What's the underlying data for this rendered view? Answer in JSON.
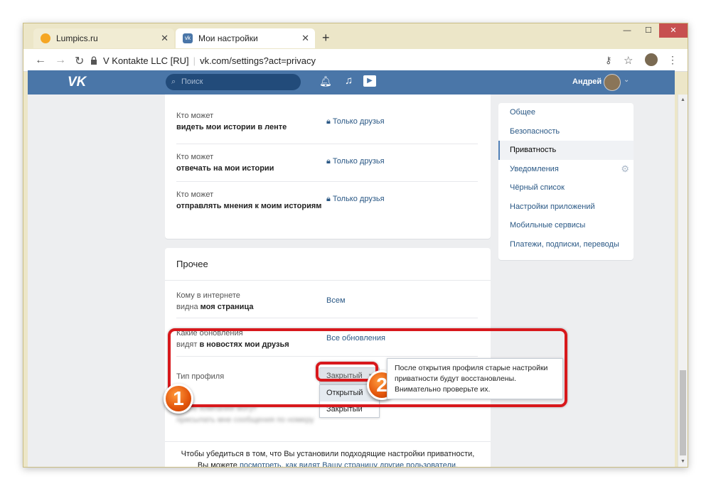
{
  "browser": {
    "tabs": [
      {
        "title": "Lumpics.ru",
        "active": false,
        "icon": "lumpics-favicon-icon"
      },
      {
        "title": "Мои настройки",
        "active": true,
        "icon": "vk-favicon-icon"
      }
    ],
    "new_tab": "+",
    "url_owner": "V Kontakte LLC [RU]",
    "url": "vk.com/settings?act=privacy",
    "window_controls": {
      "minimize": "—",
      "maximize": "☐",
      "close": "✕"
    }
  },
  "vk_header": {
    "logo": "VK",
    "search_placeholder": "Поиск",
    "user_name": "Андрей"
  },
  "privacy_rows": [
    {
      "line1": "Кто может",
      "line2": "видеть мои истории в ленте",
      "value": "Только друзья"
    },
    {
      "line1": "Кто может",
      "line2": "отвечать на мои истории",
      "value": "Только друзья"
    },
    {
      "line1": "Кто может",
      "line2": "отправлять мнения к моим историям",
      "value": "Только друзья"
    }
  ],
  "other_section": {
    "title": "Прочее",
    "rows": [
      {
        "line1": "Кому в интернете",
        "line2a": "видна ",
        "line2b": "моя страница",
        "value": "Всем"
      },
      {
        "line1": "Какие обновления",
        "line2a": "видят ",
        "line2b": "в новостях мои друзья",
        "value": "Все обновления"
      }
    ],
    "profile_type_label": "Тип профиля",
    "profile_type_value": "Закрытый",
    "profile_type_options": [
      "Открытый",
      "Закрытый"
    ],
    "blurred_row_line1": "Какие компании могут",
    "blurred_row_line2": "присылать мне сообщения по номеру",
    "tooltip": "После открытия профиля старые настройки приватности будут восстановлены. Внимательно проверьте их.",
    "footer_text": "Чтобы убедиться в том, что Вы установили подходящие настройки приватности,",
    "footer_text2": "Вы можете ",
    "footer_link": "посмотреть, как видят Вашу страницу другие пользователи."
  },
  "settings_menu": [
    {
      "label": "Общее"
    },
    {
      "label": "Безопасность"
    },
    {
      "label": "Приватность",
      "active": true
    },
    {
      "label": "Уведомления",
      "icon": "gear-icon"
    },
    {
      "label": "Чёрный список"
    },
    {
      "label": "Настройки приложений"
    },
    {
      "label": "Мобильные сервисы"
    },
    {
      "label": "Платежи, подписки, переводы"
    }
  ],
  "annotations": {
    "badge1": "1",
    "badge2": "2"
  },
  "colors": {
    "vk_blue": "#4a76a8",
    "link": "#2a5885",
    "highlight": "#d8181c",
    "badge": "#e2540b"
  }
}
